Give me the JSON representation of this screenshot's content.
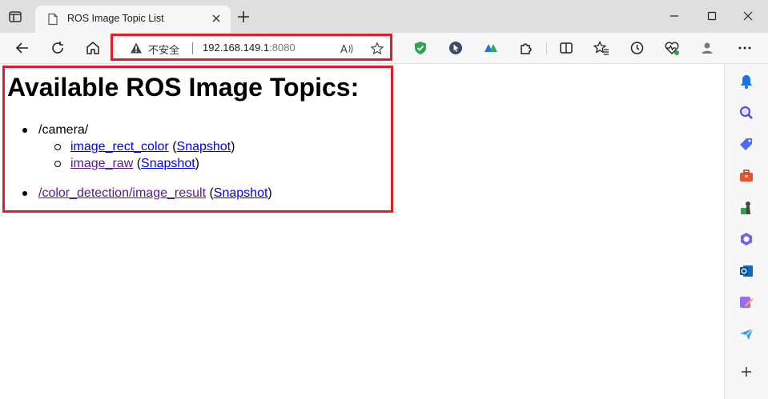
{
  "browser": {
    "tab": {
      "title": "ROS Image Topic List"
    },
    "address": {
      "security_label": "不安全",
      "host": "192.168.149.1",
      "port": ":8080"
    }
  },
  "page": {
    "heading": "Available ROS Image Topics:",
    "topics": [
      {
        "namespace": "/camera/",
        "children": [
          {
            "name": "image_rect_color",
            "snapshot": "Snapshot"
          },
          {
            "name": "image_raw",
            "snapshot": "Snapshot"
          }
        ]
      },
      {
        "name": "/color_detection/image_result",
        "snapshot": "Snapshot"
      }
    ]
  },
  "colors": {
    "highlight": "#e21d2b",
    "link": "#0000ee",
    "visited_link": "#551a8b"
  },
  "icons": [
    "tab-actions-icon",
    "page-icon",
    "close-icon",
    "plus-icon",
    "minimize-icon",
    "maximize-icon",
    "window-close-icon",
    "back-icon",
    "refresh-icon",
    "home-icon",
    "warning-icon",
    "read-aloud-icon",
    "star-icon",
    "shield-extension-icon",
    "cursor-extension-icon",
    "translate-extension-icon",
    "puzzle-icon",
    "split-screen-icon",
    "favorites-icon",
    "history-icon",
    "performance-icon",
    "profile-icon",
    "more-icon",
    "bell-icon",
    "search-icon",
    "shopping-tag-icon",
    "toolbox-icon",
    "games-icon",
    "copilot-icon",
    "outlook-icon",
    "designer-icon",
    "send-icon",
    "add-icon"
  ]
}
